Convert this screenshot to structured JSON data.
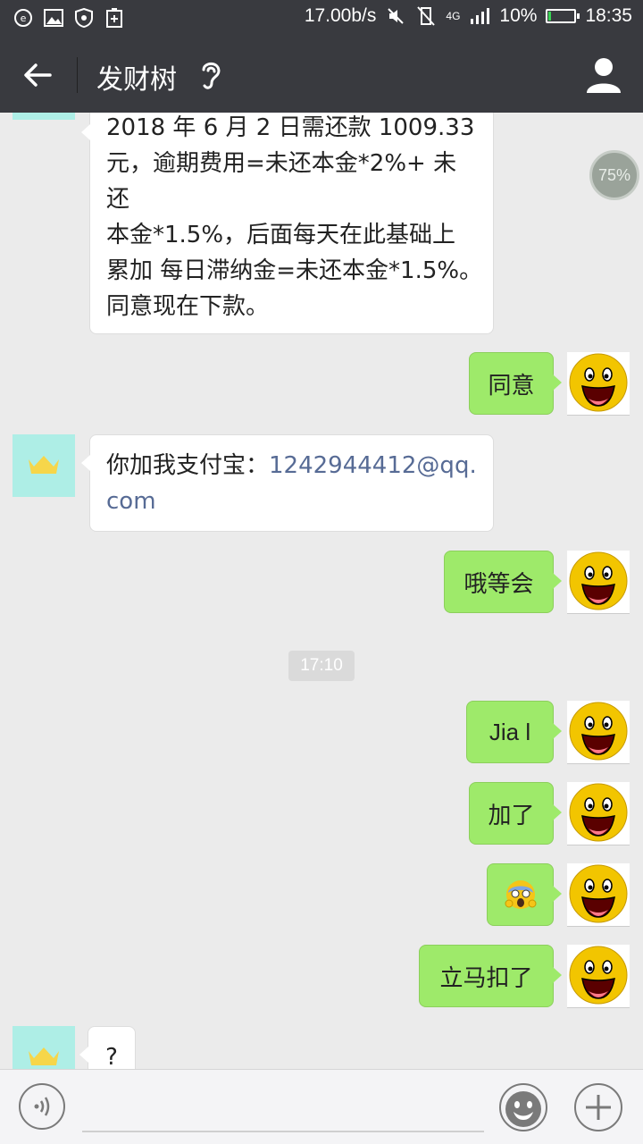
{
  "status_bar": {
    "speed": "17.00b/s",
    "network": "4G",
    "battery": "10%",
    "battery_level": 0.1,
    "time": "18:35"
  },
  "header": {
    "title": "发财树"
  },
  "messages": {
    "m1_lines": [
      "2018 年 6 月 2 日需还款 1009.33",
      "元，逾期费用=未还本金*2%+ 未还",
      "本金*1.5%，后面每天在此基础上",
      "累加 每日滞纳金=未还本金*1.5%。",
      "同意现在下款。"
    ],
    "m2": "同意",
    "m3_prefix": "你加我支付宝：",
    "m3_email_line1": "1242944412@qq.",
    "m3_email_line2": "com",
    "m4": "哦等会",
    "timestamp": "17:10",
    "m5": "Jia l",
    "m6": "加了",
    "m7": "😱",
    "m8": "立马扣了",
    "m9": "?"
  },
  "progress_badge": "75%",
  "colors": {
    "titlebar": "#393a3f",
    "sent_bubble": "#9eea6a",
    "received_bubble": "#ffffff",
    "chat_bg": "#ebebeb",
    "link": "#576b95"
  },
  "icons": {
    "back": "arrow-left",
    "ear": "ear",
    "profile": "person",
    "voice": "voice",
    "emoji": "smiley",
    "plus": "plus"
  }
}
